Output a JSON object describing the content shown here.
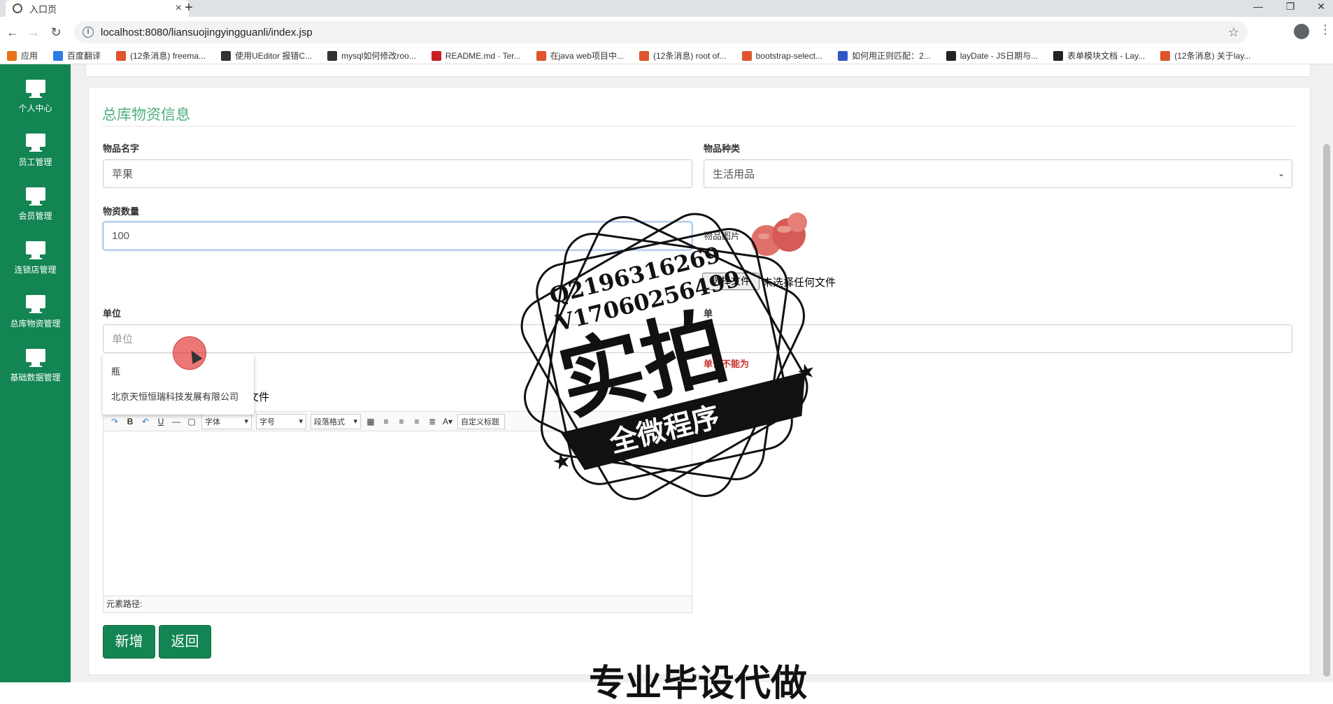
{
  "browser": {
    "tab_title": "入口页",
    "tab_close": "×",
    "new_tab": "+",
    "url": "localhost:8080/liansuojingyingguanli/index.jsp",
    "bookmarks": [
      {
        "label": "应用",
        "color": "#e8711a"
      },
      {
        "label": "百度翻译",
        "color": "#2d7be5"
      },
      {
        "label": "(12条消息) freema...",
        "color": "#e0542e"
      },
      {
        "label": "使用UEditor 报错C...",
        "color": "#333333"
      },
      {
        "label": "mysql如何修改roo...",
        "color": "#333333"
      },
      {
        "label": "README.md · Ter...",
        "color": "#c71d23"
      },
      {
        "label": "在java web项目中...",
        "color": "#e0542e"
      },
      {
        "label": "(12条消息) root of...",
        "color": "#e0542e"
      },
      {
        "label": "bootstrap-select...",
        "color": "#e0542e"
      },
      {
        "label": "如何用正则匹配：2...",
        "color": "#3255c8"
      },
      {
        "label": "layDate - JS日期与...",
        "color": "#222222"
      },
      {
        "label": "表单模块文档 - Lay...",
        "color": "#222222"
      },
      {
        "label": "(12条消息) 关于lay...",
        "color": "#e0542e"
      }
    ]
  },
  "sidebar": {
    "items": [
      {
        "label": "个人中心"
      },
      {
        "label": "员工管理"
      },
      {
        "label": "会员管理"
      },
      {
        "label": "连锁店管理"
      },
      {
        "label": "总库物资管理"
      },
      {
        "label": "基础数据管理"
      }
    ],
    "accent": "#138552"
  },
  "form": {
    "title": "总库物资信息",
    "name_label": "物品名字",
    "name_value": "苹果",
    "type_label": "物品种类",
    "type_value": "生活用品",
    "qty_label": "物资数量",
    "qty_value": "100",
    "image_label": "物品图片",
    "file_button": "选择文件",
    "file_none": "未选择任何文件",
    "file_none_partial": "何文件",
    "unit_label": "单位",
    "unit_placeholder": "单位",
    "unit_right_label": "单",
    "unit_error": "单位不能为",
    "dropdown_options": [
      "瓶",
      "北京天恒恒瑞科技发展有限公司"
    ]
  },
  "editor": {
    "font_select": "字体",
    "size_select": "字号",
    "para_select": "段落格式",
    "custom_title": "自定义标题",
    "status_label": "元素路径:"
  },
  "buttons": {
    "add": "新增",
    "back": "返回"
  },
  "watermark": {
    "line1": "Q2196316269",
    "line2": "V17060256499",
    "big": "实拍",
    "ribbon": "全微程序",
    "bottom": "专业毕设代做"
  }
}
